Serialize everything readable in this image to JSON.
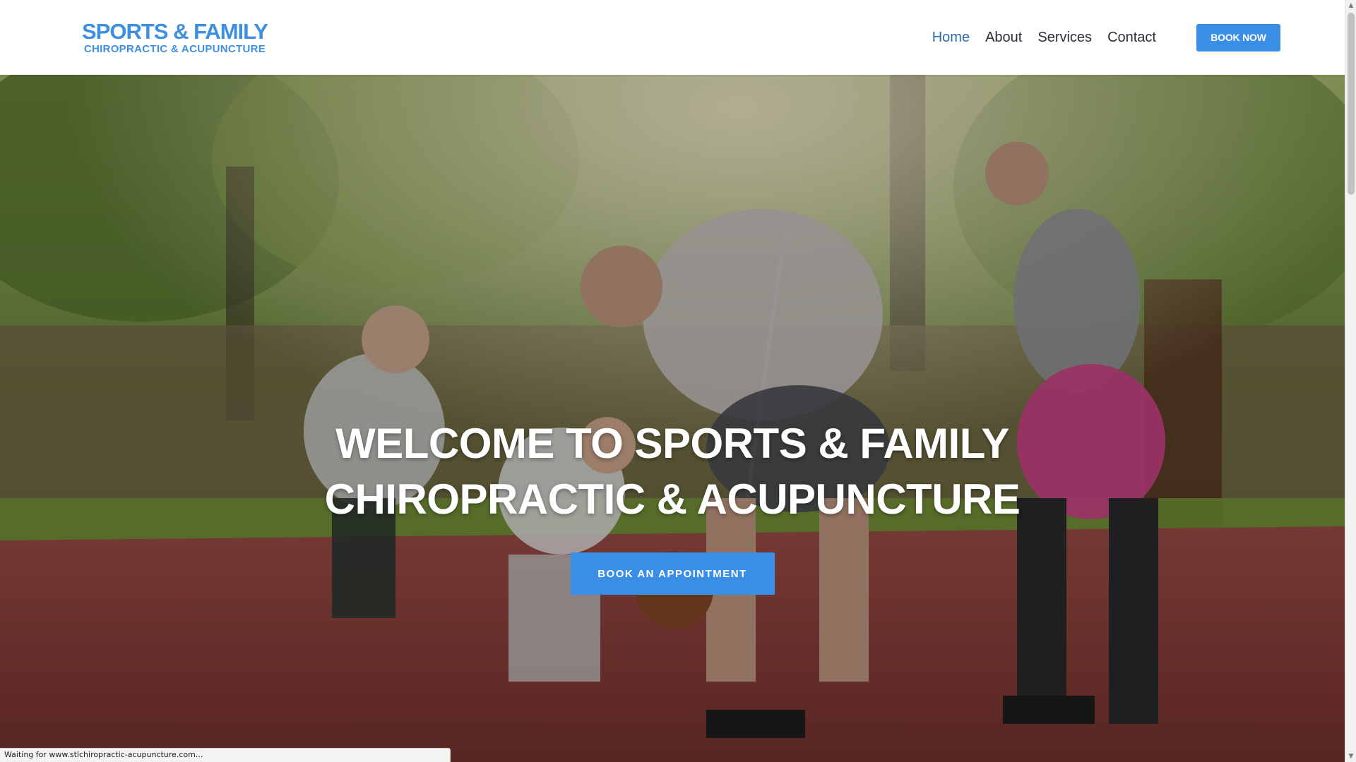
{
  "header": {
    "logo": {
      "line1": "SPORTS & FAMILY",
      "line2": "CHIROPRACTIC & ACUPUNCTURE"
    },
    "nav": [
      {
        "label": "Home",
        "active": true
      },
      {
        "label": "About",
        "active": false
      },
      {
        "label": "Services",
        "active": false
      },
      {
        "label": "Contact",
        "active": false
      }
    ],
    "book_now_label": "BOOK NOW"
  },
  "hero": {
    "title_line1": "WELCOME TO SPORTS & FAMILY",
    "title_line2": "CHIROPRACTIC & ACUPUNCTURE",
    "cta_label": "BOOK AN APPOINTMENT"
  },
  "status_bar": {
    "text": "Waiting for www.stlchiropractic-acupuncture.com..."
  },
  "colors": {
    "brand_blue": "#3a8ee6",
    "logo_blue": "#3e8fe0",
    "nav_active": "#2f6aa6",
    "nav_text": "#2b2f36"
  },
  "icons": {
    "scroll_up": "chevron-up-icon",
    "scroll_down": "chevron-down-icon"
  }
}
